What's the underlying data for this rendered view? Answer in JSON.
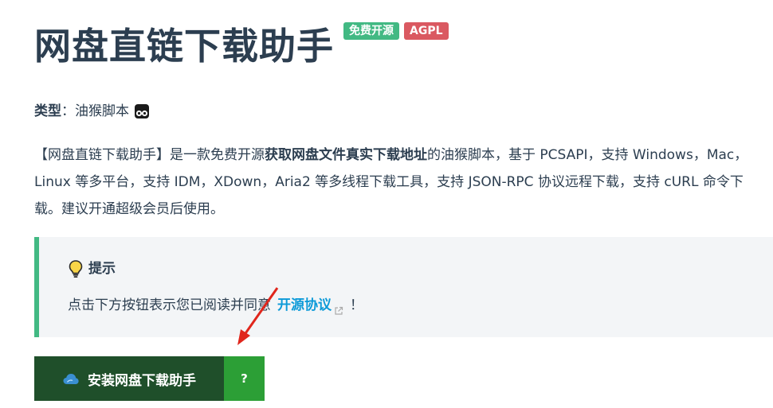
{
  "header": {
    "title": "网盘直链下载助手",
    "badges": [
      "免费开源",
      "AGPL"
    ]
  },
  "type_line": {
    "label": "类型",
    "separator": "：",
    "value": "油猴脚本"
  },
  "description": {
    "part1": "【网盘直链下载助手】是一款免费开源",
    "bold": "获取网盘文件真实下载地址",
    "part2": "的油猴脚本，基于 PCSAPI，支持 Windows，Mac，Linux 等多平台，支持 IDM，XDown，Aria2 等多线程下载工具，支持 JSON-RPC 协议远程下载，支持 cURL 命令下载。建议开通超级会员后使用。"
  },
  "tip": {
    "title": "提示",
    "text_before": "点击下方按钮表示您已阅读并同意",
    "link": "开源协议",
    "text_after": "！"
  },
  "install": {
    "label": "安装网盘下载助手",
    "help_label": "?"
  },
  "colors": {
    "accent_green": "#42b983",
    "badge_red": "#da5961",
    "link_blue": "#0c9ad8",
    "install_dark_green": "#1f4f2a",
    "help_green": "#2c9f36",
    "arrow_red": "#e0261c"
  },
  "icons": {
    "type": "tampermonkey-icon",
    "tip": "lightbulb-icon",
    "link": "external-link-icon",
    "install": "cloud-icon"
  }
}
